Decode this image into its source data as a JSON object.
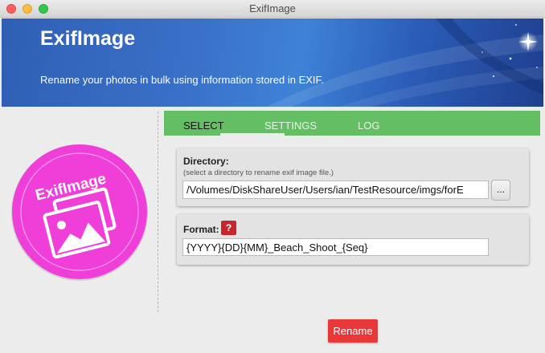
{
  "window": {
    "title": "ExifImage"
  },
  "banner": {
    "title": "ExifImage",
    "subtitle": "Rename your photos in bulk using information stored in EXIF."
  },
  "logo": {
    "text": "ExifImage",
    "icon": "photos-icon",
    "color": "#f03fd9"
  },
  "tabs": [
    {
      "label": "SELECT",
      "active": true
    },
    {
      "label": "SETTINGS",
      "active": false
    },
    {
      "label": "LOG",
      "active": false
    }
  ],
  "directory": {
    "label": "Directory:",
    "hint": "(select a directory to rename exif image file.)",
    "value": "/Volumes/DiskShareUser/Users/ian/TestResource/imgs/forE",
    "browse_label": "..."
  },
  "format": {
    "label": "Format:",
    "help_label": "?",
    "value": "{YYYY}{DD}{MM}_Beach_Shoot_{Seq}"
  },
  "actions": {
    "rename_label": "Rename"
  },
  "colors": {
    "accent_green": "#64bf64",
    "rename_red": "#e8383a",
    "help_red": "#c8262c",
    "banner_blue": "#3a70c8"
  }
}
